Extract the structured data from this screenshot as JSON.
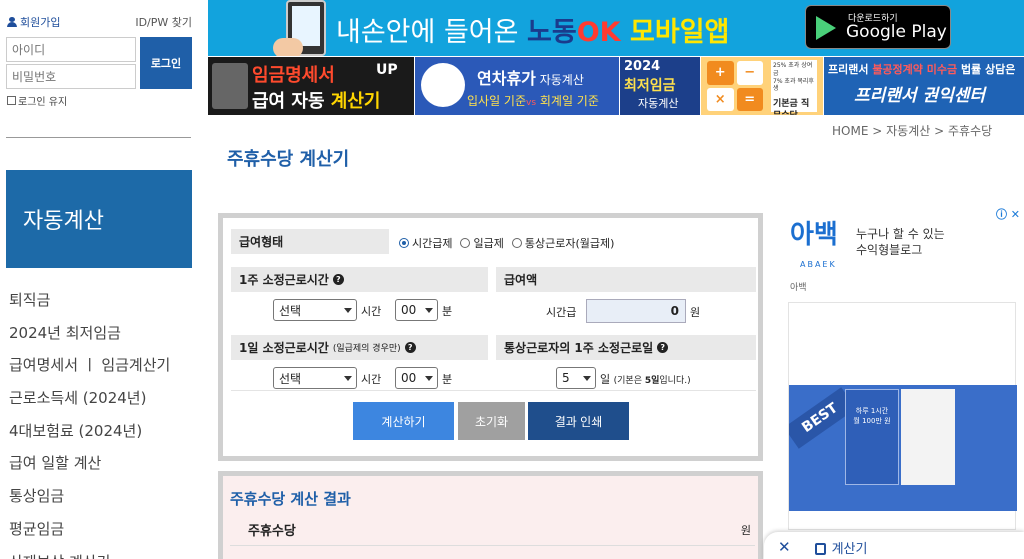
{
  "auth": {
    "signup": "회원가입",
    "find": "ID/PW 찾기",
    "id_placeholder": "아이디",
    "pw_placeholder": "비밀번호",
    "login": "로그인",
    "keep": "로그인 유지"
  },
  "sidebar": {
    "banner": "자동계산",
    "items": [
      {
        "label": "퇴직금"
      },
      {
        "label": "2024년 최저임금"
      },
      {
        "label": "급여명세서 ㅣ 임금계산기"
      },
      {
        "label": "근로소득세 (2024년)"
      },
      {
        "label": "4대보험료 (2024년)"
      },
      {
        "label": "급여 일할 계산"
      },
      {
        "label": "통상임금"
      },
      {
        "label": "평균임금"
      },
      {
        "label": "산재보상 계산기"
      }
    ]
  },
  "top_banner": {
    "text_pre": "내손안에 들어온 ",
    "nodong": "노동",
    "ok": "OK",
    "app": " 모바일앱",
    "gplay_small": "다운로드하기",
    "gplay_big": "Google Play"
  },
  "ads": {
    "ad1": {
      "line1": "임금명세서",
      "up": "UP",
      "line2a": "급여 자동 ",
      "line2b": "계산기"
    },
    "ad2": {
      "title": "연차휴가",
      "title_s": " 자동계산",
      "sub1": "입사일 기준",
      "vs": "vs",
      "sub2": "회계일 기준"
    },
    "ad3": {
      "year": "2024",
      "title": "최저임금",
      "sub": "자동계산"
    },
    "ad4": {
      "keys": [
        "+",
        "−",
        "×",
        "="
      ],
      "paper_top": "25% 초과 상여금",
      "paper_mid": "7% 초과 복리후생",
      "paper_bold": "기본금 직무수당"
    },
    "ad5": {
      "line1a": "프리랜서 ",
      "line1b": "불공정계약 미수금",
      "line1c": " 법률 상담은",
      "line2": "프리랜서 권익센터"
    }
  },
  "breadcrumb": {
    "home": "HOME",
    "sep": ">",
    "c1": "자동계산",
    "c2": "주휴수당"
  },
  "page_title": "주휴수당 계산기",
  "form": {
    "pay_type_label": "급여형태",
    "pay_types": [
      "시간급제",
      "일급제",
      "통상근로자(월급제)"
    ],
    "weekly_hours_label": "1주 소정근로시간",
    "amount_label": "급여액",
    "daily_hours_label": "1일 소정근로시간",
    "daily_hours_note": "(일급제의 경우만)",
    "weekly_days_label": "통상근로자의 1주 소정근로일",
    "select_placeholder": "선택",
    "hour_unit": "시간",
    "minute_value": "00",
    "minute_unit": "분",
    "hourly_label": "시간급",
    "amount_value": "0",
    "won": "원",
    "days_value": "5",
    "day_unit": "일",
    "days_note": "(기본은 ",
    "days_note_bold": "5일",
    "days_note_end": "입니다.)",
    "btn_calc": "계산하기",
    "btn_reset": "초기화",
    "btn_print": "결과 인쇄"
  },
  "result": {
    "title": "주휴수당 계산 결과",
    "label": "주휴수당",
    "unit": "원"
  },
  "right_ad": {
    "logo": "아백",
    "sub": "ABAEK",
    "text1": "누구나 할 수 있는",
    "text2": "수익형블로그",
    "name": "아백",
    "best": "BEST",
    "book1": "하루 1시간",
    "book2": "월 100만 원"
  },
  "float_bar": {
    "close": "✕",
    "label": "계산기"
  }
}
